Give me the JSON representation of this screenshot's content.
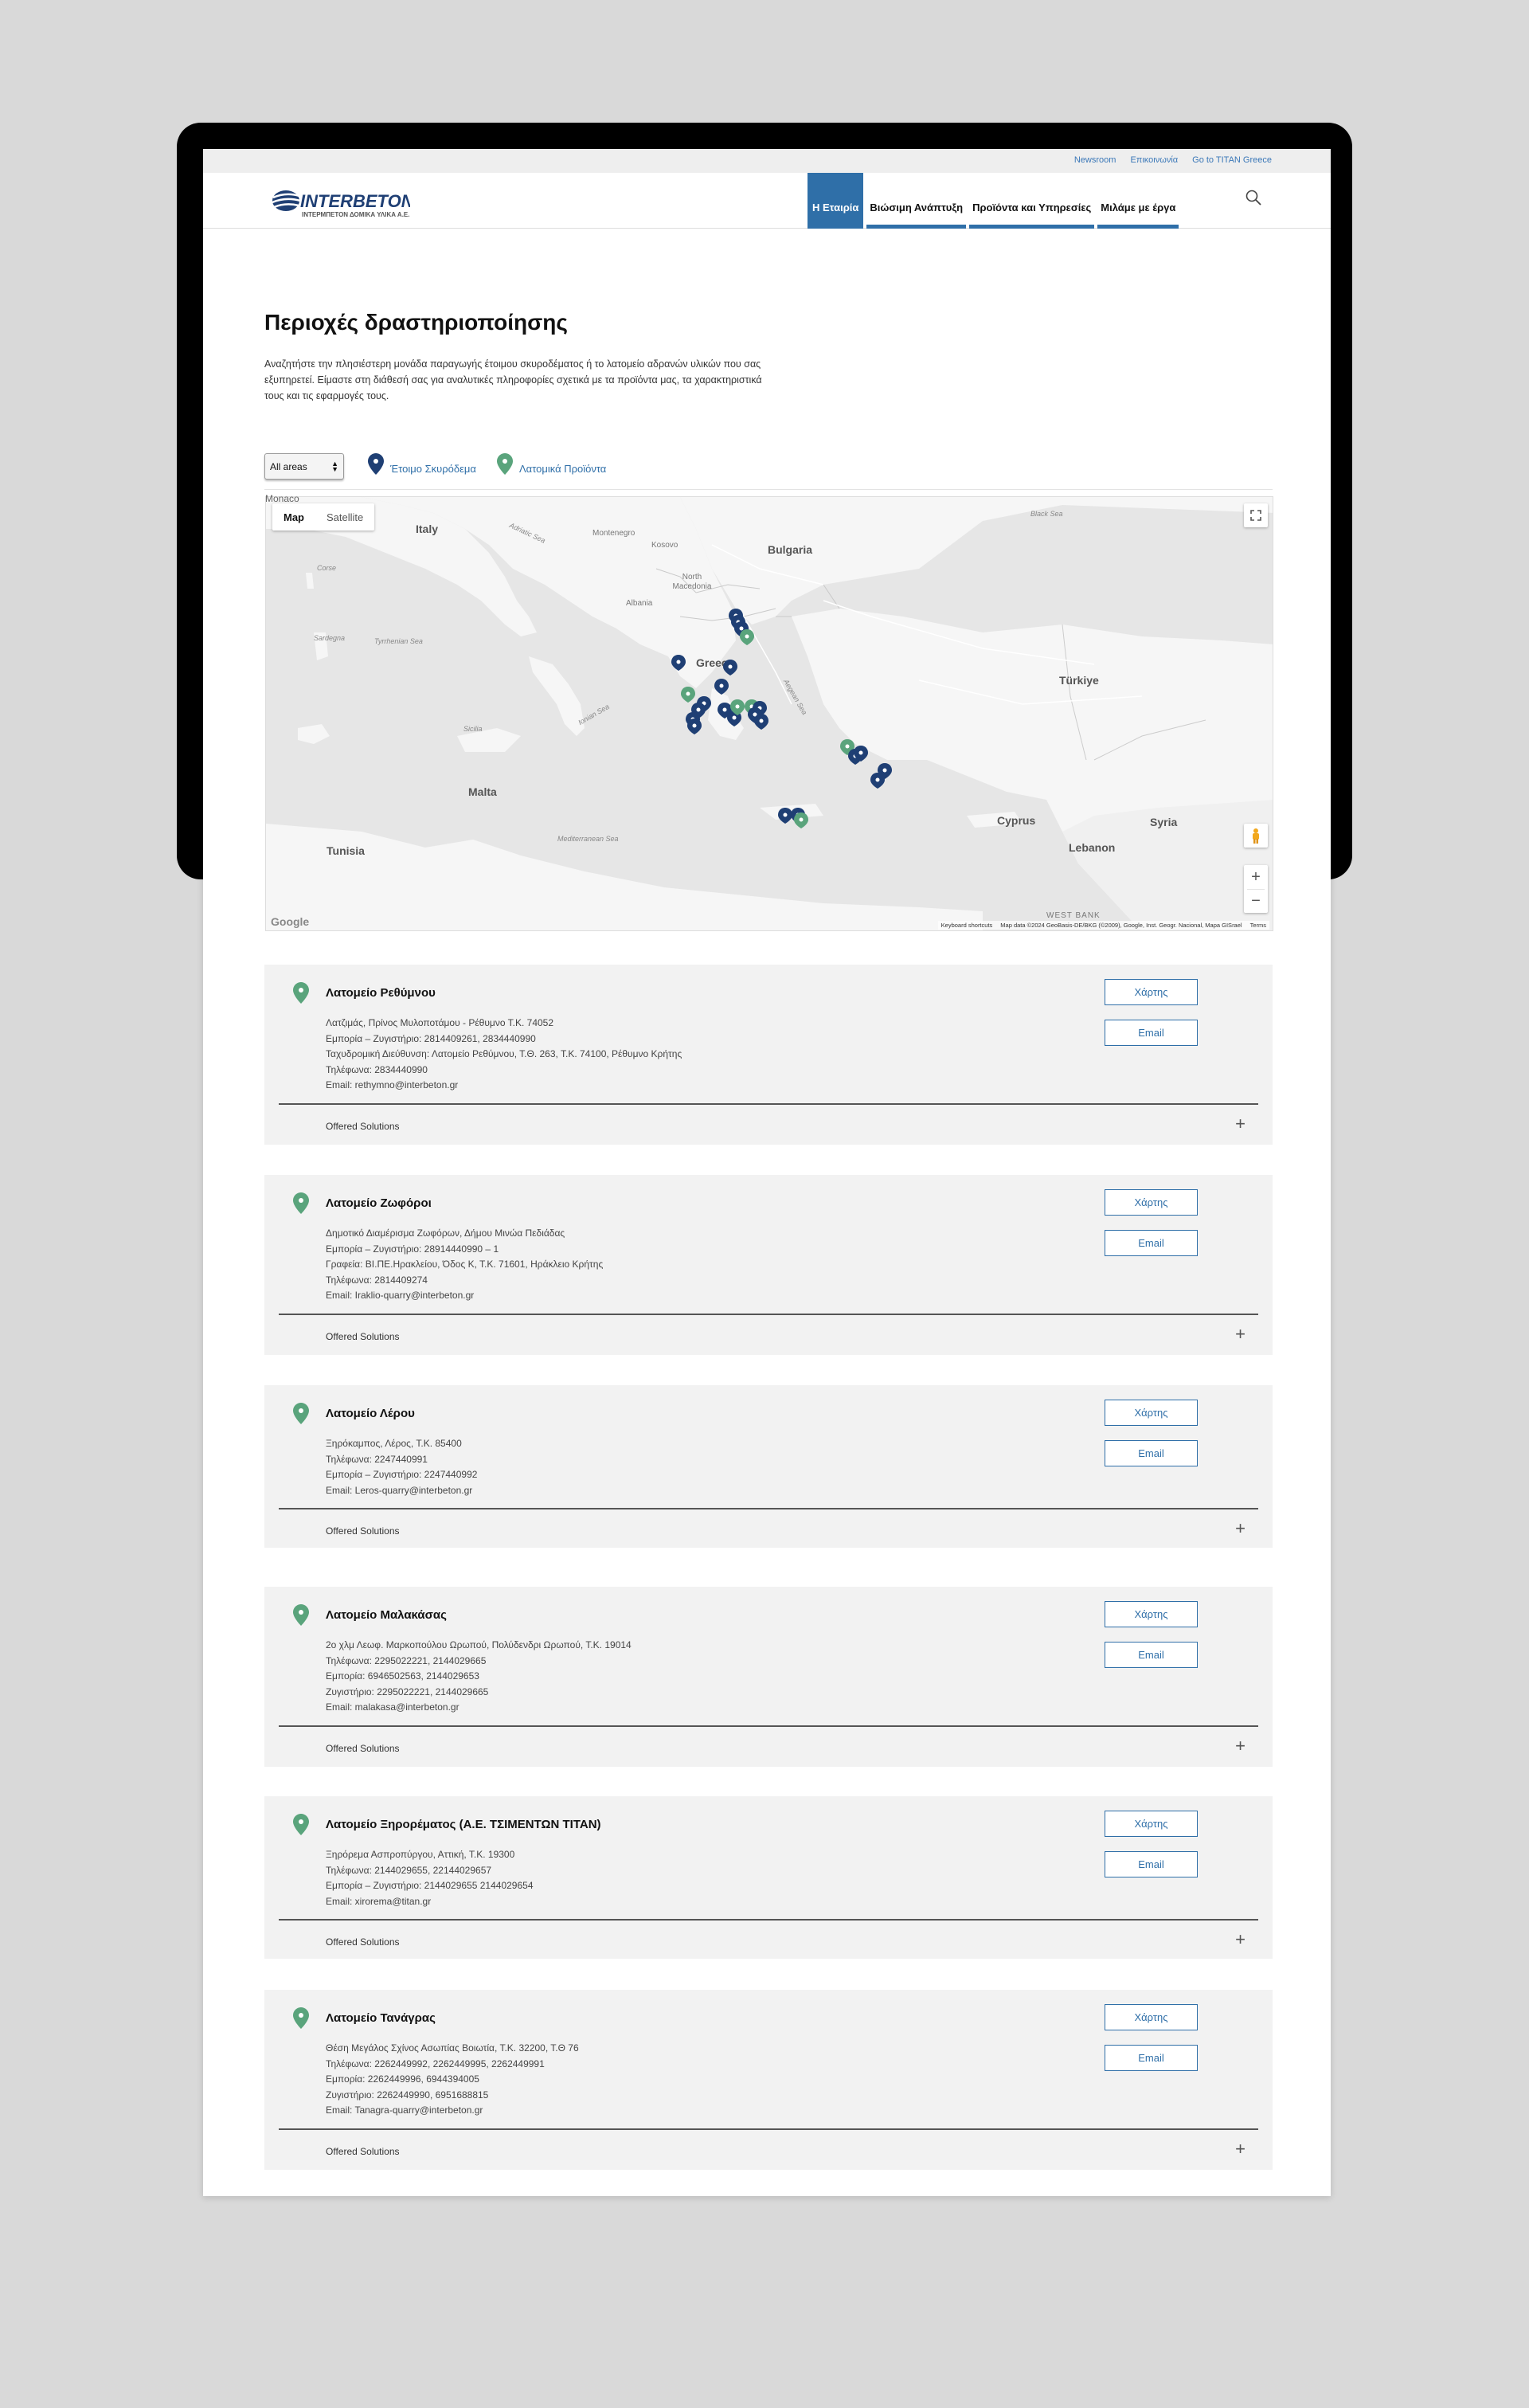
{
  "topbar": {
    "links": [
      "Newsroom",
      "Επικοινωνία",
      "Go to TITAN Greece"
    ]
  },
  "logo": {
    "name": "INTERBETON",
    "tagline": "ΙΝΤΕΡΜΠΕΤΟΝ ΔΟΜΙΚΑ ΥΛΙΚΑ Α.Ε."
  },
  "nav": {
    "tabs": [
      {
        "label": "Η Εταιρία",
        "active": true
      },
      {
        "label": "Βιώσιμη Ανάπτυξη",
        "active": false
      },
      {
        "label": "Προϊόντα και Υπηρεσίες",
        "active": false
      },
      {
        "label": "Μιλάμε με έργα",
        "active": false
      }
    ],
    "search_icon": "search-icon"
  },
  "page": {
    "title": "Περιοχές δραστηριοποίησης",
    "intro": "Αναζητήστε την πλησιέστερη μονάδα παραγωγής έτοιμου σκυροδέματος ή το λατομείο αδρανών υλικών που σας εξυπηρετεί. Είμαστε στη διάθεσή σας για αναλυτικές πληροφορίες σχετικά με τα προϊόντα μας, τα χαρακτηριστικά τους και τις εφαρμογές τους."
  },
  "filter": {
    "select_value": "All areas",
    "legend": [
      {
        "label": "Έτοιμο Σκυρόδεμα",
        "color": "#1f3f74"
      },
      {
        "label": "Λατομικά Προϊόντα",
        "color": "#5aa47c"
      }
    ]
  },
  "map": {
    "types": [
      "Map",
      "Satellite"
    ],
    "selected_type": "Map",
    "overflow_label": "Monaco",
    "countries": [
      "Italy",
      "Montenegro",
      "Kosovo",
      "Bulgaria",
      "North Macedonia",
      "Albania",
      "Greece",
      "Türkiye",
      "Malta",
      "Tunisia",
      "Cyprus",
      "Syria",
      "Lebanon",
      "WEST BANK"
    ],
    "small_labels": [
      "Corse",
      "Sardegna",
      "Black Sea"
    ],
    "seas": [
      "Adriatic Sea",
      "Tyrrhenian Sea",
      "Ionian Sea",
      "Sicilia",
      "Aegean Sea",
      "Mediterranean Sea"
    ],
    "attribution": [
      "Keyboard shortcuts",
      "Map data ©2024 GeoBasis-DE/BKG (©2009), Google, Inst. Geogr. Nacional, Mapa GISrael",
      "Terms"
    ],
    "brand": "Google",
    "zoom_in": "+",
    "zoom_out": "−"
  },
  "quarries": [
    {
      "name": "Λατομείο Ρεθύμνου",
      "lines": [
        "Λατζιμάς, Πρίνος Μυλοποτάμου - Ρέθυμνο Τ.Κ. 74052",
        "Εμπορία – Ζυγιστήριο: 2814409261, 2834440990",
        "Ταχυδρομική Διεύθυνση: Λατομείο Ρεθύμνου, Τ.Θ. 263, Τ.Κ. 74100, Ρέθυμνο Κρήτης",
        "Τηλέφωνα: 2834440990",
        "Email: rethymno@interbeton.gr"
      ],
      "map_label": "Χάρτης",
      "email_label": "Email",
      "offered": "Offered Solutions"
    },
    {
      "name": "Λατομείο Ζωφόροι",
      "lines": [
        "Δημοτικό Διαμέρισμα Ζωφόρων, Δήμου Μινώα Πεδιάδας",
        "Εμπορία – Ζυγιστήριο: 28914440990 – 1",
        "Γραφεία: ΒΙ.ΠΕ.Ηρακλείου, Όδος Κ, Τ.Κ. 71601, Ηράκλειο Κρήτης",
        "Τηλέφωνα: 2814409274",
        "Email: Iraklio-quarry@interbeton.gr"
      ],
      "map_label": "Χάρτης",
      "email_label": "Email",
      "offered": "Offered Solutions"
    },
    {
      "name": "Λατομείο Λέρου",
      "lines": [
        "Ξηρόκαμπος, Λέρος, Τ.Κ. 85400",
        "Τηλέφωνα: 2247440991",
        "Εμπορία – Ζυγιστήριο: 2247440992",
        "Email: Leros-quarry@interbeton.gr"
      ],
      "map_label": "Χάρτης",
      "email_label": "Email",
      "offered": "Offered Solutions"
    },
    {
      "name": "Λατομείο Μαλακάσας",
      "lines": [
        "2ο χλμ Λεωφ. Μαρκοπούλου Ωρωπού, Πολύδενδρι Ωρωπού, Τ.Κ. 19014",
        "Τηλέφωνα: 2295022221, 2144029665",
        "Εμπορία: 6946502563, 2144029653",
        "Ζυγιστήριο: 2295022221, 2144029665",
        "Email: malakasa@interbeton.gr"
      ],
      "map_label": "Χάρτης",
      "email_label": "Email",
      "offered": "Offered Solutions"
    },
    {
      "name": "Λατομείο Ξηρορέματος (Α.Ε. ΤΣΙΜΕΝΤΩΝ ΤΙΤΑΝ)",
      "lines": [
        "Ξηρόρεμα Ασπροπύργου, Αττική, Τ.Κ. 19300",
        "Τηλέφωνα: 2144029655, 22144029657",
        "Εμπορία – Ζυγιστήριο: 2144029655 2144029654",
        "Email: xirorema@titan.gr"
      ],
      "map_label": "Χάρτης",
      "email_label": "Email",
      "offered": "Offered Solutions"
    },
    {
      "name": "Λατομείο Τανάγρας",
      "lines": [
        "Θέση Μεγάλος Σχίνος Ασωπίας Βοιωτία, Τ.Κ. 32200, Τ.Θ 76",
        "Τηλέφωνα: 2262449992, 2262449995, 2262449991",
        "Εμπορία: 2262449996, 6944394005",
        "Ζυγιστήριο: 2262449990, 6951688815",
        "Email: Tanagra-quarry@interbeton.gr"
      ],
      "map_label": "Χάρτης",
      "email_label": "Email",
      "offered": "Offered Solutions"
    }
  ]
}
